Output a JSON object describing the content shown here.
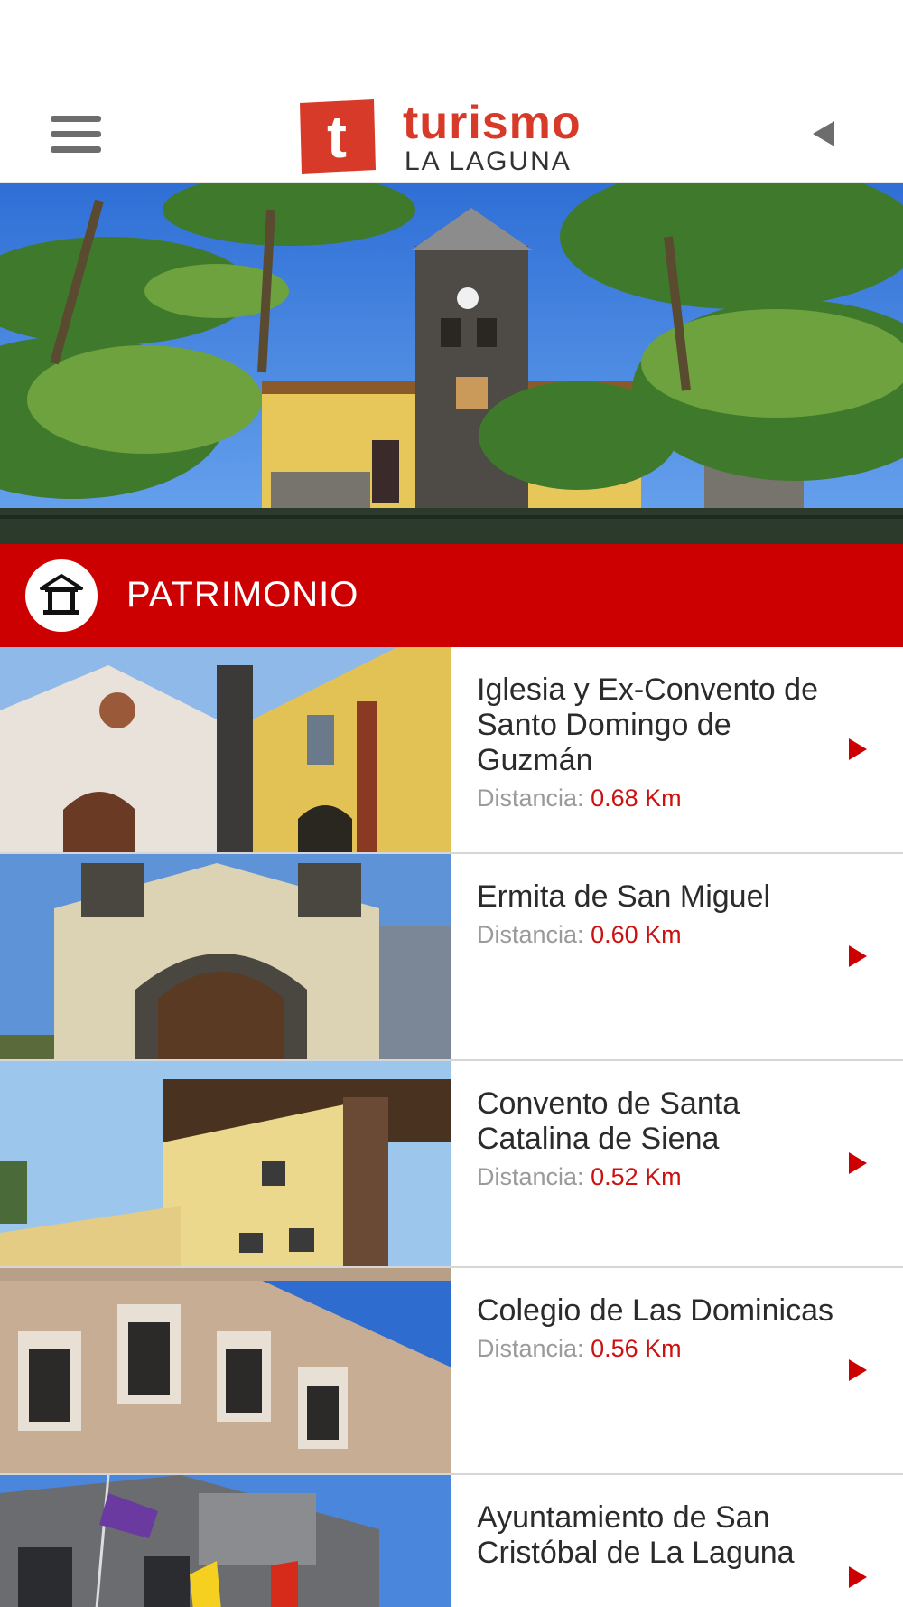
{
  "header": {
    "logo_letter": "t",
    "logo_title": "turismo",
    "logo_subtitle": "LA LAGUNA",
    "menu_icon": "hamburger-menu-icon",
    "back_icon": "back-triangle-icon"
  },
  "section": {
    "title": "PATRIMONIO",
    "icon": "monument-icon"
  },
  "colors": {
    "brand_red": "#cc0000",
    "logo_red": "#d83a2a",
    "distance_red": "#cc1111"
  },
  "items": [
    {
      "title": "Iglesia y Ex-Convento de Santo Domingo de Guzmán",
      "distance_label": "Distancia:",
      "distance_value": "0.68 Km"
    },
    {
      "title": "Ermita de San Miguel",
      "distance_label": "Distancia:",
      "distance_value": "0.60 Km"
    },
    {
      "title": "Convento de Santa Catalina de Siena",
      "distance_label": "Distancia:",
      "distance_value": "0.52 Km"
    },
    {
      "title": "Colegio de Las Dominicas",
      "distance_label": "Distancia:",
      "distance_value": "0.56 Km"
    },
    {
      "title": "Ayuntamiento de San Cristóbal de La Laguna",
      "distance_label": "",
      "distance_value": ""
    }
  ]
}
